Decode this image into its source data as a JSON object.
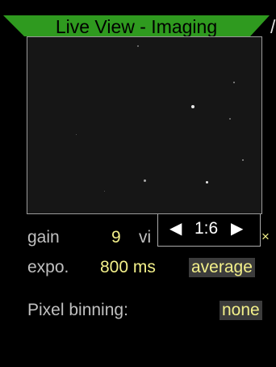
{
  "header": {
    "title": "Live View - Imaging",
    "tail": "/"
  },
  "zoom": {
    "left_arrow": "◀",
    "value": "1:6",
    "right_arrow": "▶"
  },
  "settings": {
    "gain_label": "gain",
    "gain_value": "9",
    "view_label_partial": "vi",
    "close_symbol": "×",
    "exposure_label": "expo.",
    "exposure_value": "800 ms",
    "mode_value": "average",
    "binning_label": "Pixel binning:",
    "binning_value": "none"
  },
  "colors": {
    "title_banner": "#2f9a1f",
    "accent_yellow": "#f3f08a",
    "chip_background": "#3c3c3c"
  }
}
